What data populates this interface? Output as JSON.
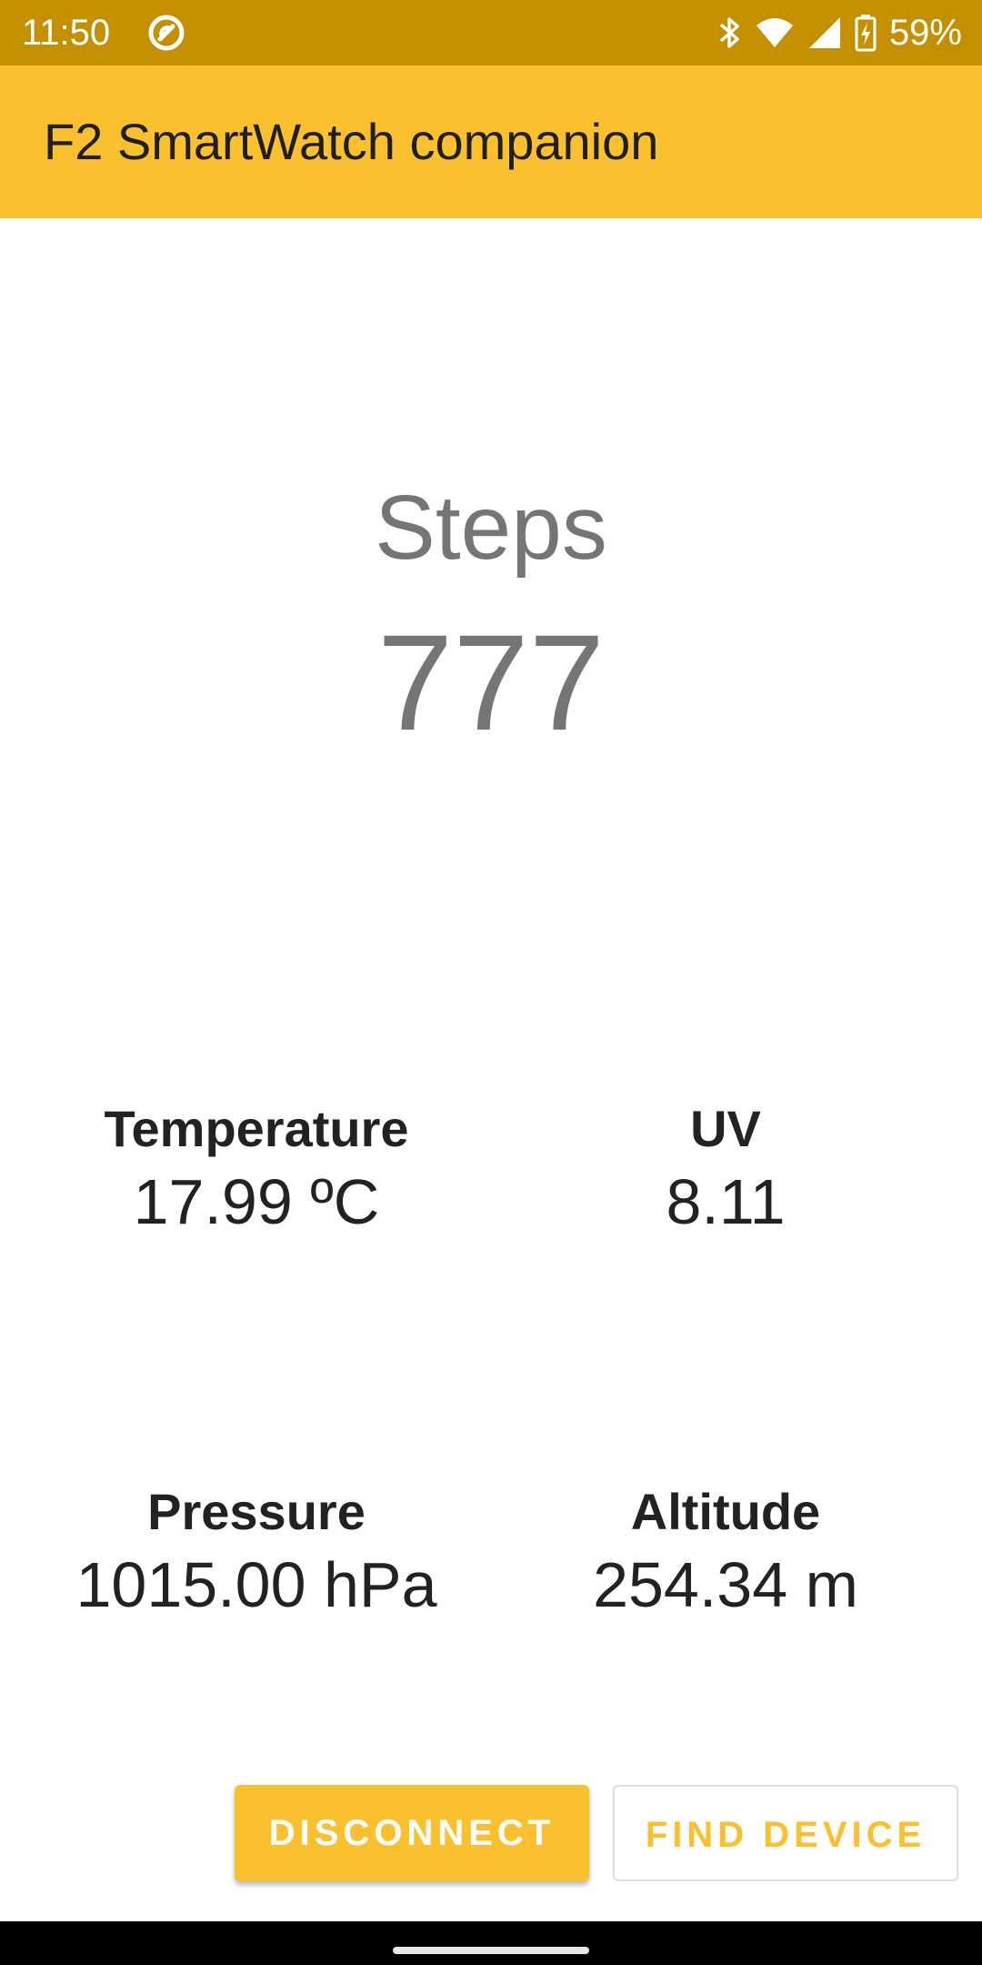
{
  "status_bar": {
    "time": "11:50",
    "battery_percent": "59%",
    "icons": [
      "app-notification-icon",
      "bluetooth-icon",
      "wifi-icon",
      "cellular-signal-icon",
      "battery-charging-icon"
    ],
    "background_color": "#c49000"
  },
  "app_bar": {
    "title": "F2 SmartWatch companion",
    "background_color": "#fbc02d"
  },
  "steps": {
    "label": "Steps",
    "value": "777"
  },
  "metrics": {
    "temperature": {
      "label": "Temperature",
      "value": "17.99 ºC"
    },
    "uv": {
      "label": "UV",
      "value": "8.11"
    },
    "pressure": {
      "label": "Pressure",
      "value": "1015.00 hPa"
    },
    "altitude": {
      "label": "Altitude",
      "value": "254.34 m"
    }
  },
  "buttons": {
    "disconnect": "DISCONNECT",
    "find_device": "FIND DEVICE"
  },
  "colors": {
    "accent": "#fbc02d",
    "accent_dark": "#c49000",
    "steps_text": "#757575",
    "metric_text": "#222222"
  }
}
